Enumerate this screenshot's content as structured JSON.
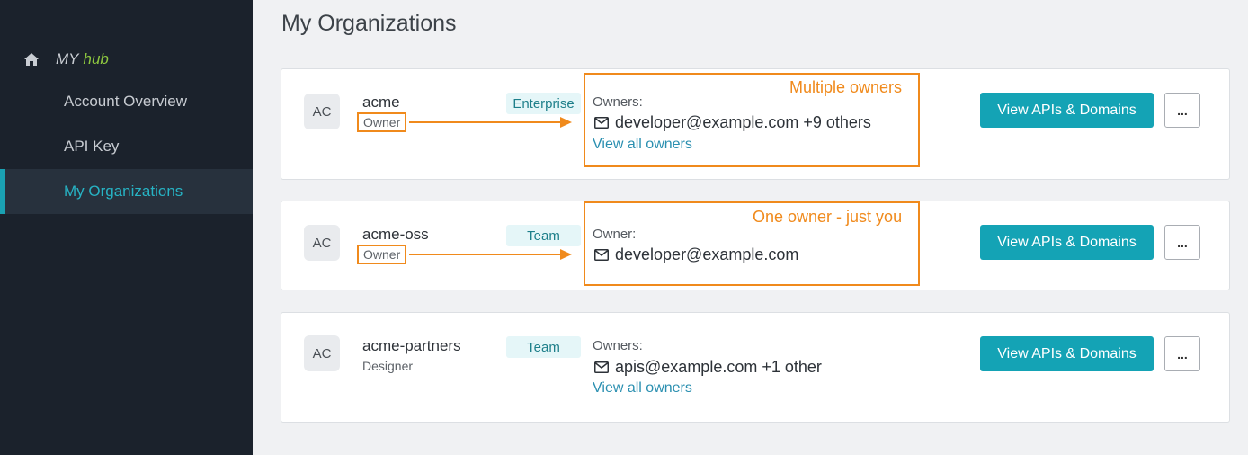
{
  "sidebar": {
    "brand_my": "MY",
    "brand_hub": "hub",
    "items": [
      {
        "label": "Account Overview"
      },
      {
        "label": "API Key"
      },
      {
        "label": "My Organizations"
      }
    ],
    "active_index": 2
  },
  "main": {
    "title": "My Organizations",
    "organizations": [
      {
        "initials": "AC",
        "name": "acme",
        "role": "Owner",
        "plan": "Enterprise",
        "owners_label": "Owners:",
        "owners_text": "developer@example.com +9 others",
        "view_all": "View all owners",
        "view_button": "View APIs & Domains",
        "more_button": "..."
      },
      {
        "initials": "AC",
        "name": "acme-oss",
        "role": "Owner",
        "plan": "Team",
        "owners_label": "Owner:",
        "owners_text": "developer@example.com",
        "view_button": "View APIs & Domains",
        "more_button": "..."
      },
      {
        "initials": "AC",
        "name": "acme-partners",
        "role": "Designer",
        "plan": "Team",
        "owners_label": "Owners:",
        "owners_text": "apis@example.com +1 other",
        "view_all": "View all owners",
        "view_button": "View APIs & Domains",
        "more_button": "..."
      }
    ]
  },
  "annotations": {
    "multiple_owners": "Multiple owners",
    "one_owner": "One owner - just you"
  },
  "colors": {
    "sidebar_bg": "#1b222c",
    "accent": "#14a3b5",
    "brand_green": "#8dc63f",
    "annotation_orange": "#f08a1c",
    "link": "#2a8fb0"
  }
}
